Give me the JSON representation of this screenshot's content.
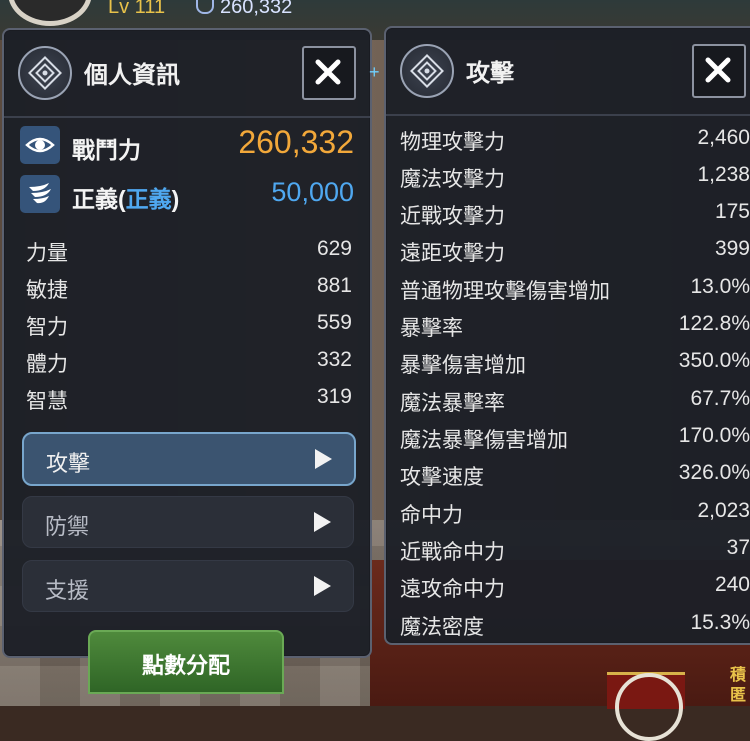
{
  "hud": {
    "level": "Lv 111",
    "combat_power": "260,332"
  },
  "left_panel": {
    "title": "個人資訊",
    "combat_power": {
      "label": "戰鬥力",
      "value": "260,332"
    },
    "justice": {
      "label_main": "正義(",
      "label_inner": "正義",
      "label_close": ")",
      "value": "50,000"
    },
    "stats": [
      {
        "label": "力量",
        "value": "629"
      },
      {
        "label": "敏捷",
        "value": "881"
      },
      {
        "label": "智力",
        "value": "559"
      },
      {
        "label": "體力",
        "value": "332"
      },
      {
        "label": "智慧",
        "value": "319"
      }
    ],
    "categories": [
      {
        "label": "攻擊",
        "active": true
      },
      {
        "label": "防禦",
        "active": false
      },
      {
        "label": "支援",
        "active": false
      }
    ],
    "distribute_button": "點數分配"
  },
  "right_panel": {
    "title": "攻擊",
    "rows": [
      {
        "label": "物理攻擊力",
        "value": "2,460"
      },
      {
        "label": "魔法攻擊力",
        "value": "1,238"
      },
      {
        "label": "近戰攻擊力",
        "value": "175"
      },
      {
        "label": "遠距攻擊力",
        "value": "399"
      },
      {
        "label": "普通物理攻擊傷害增加",
        "value": "13.0%"
      },
      {
        "label": "暴擊率",
        "value": "122.8%"
      },
      {
        "label": "暴擊傷害增加",
        "value": "350.0%"
      },
      {
        "label": "魔法暴擊率",
        "value": "67.7%"
      },
      {
        "label": "魔法暴擊傷害增加",
        "value": "170.0%"
      },
      {
        "label": "攻擊速度",
        "value": "326.0%"
      },
      {
        "label": "命中力",
        "value": "2,023"
      },
      {
        "label": "近戰命中力",
        "value": "37"
      },
      {
        "label": "遠攻命中力",
        "value": "240"
      },
      {
        "label": "魔法密度",
        "value": "15.3%"
      }
    ]
  },
  "badge_text": "積匿",
  "colors": {
    "power": "#f2a83a",
    "justice": "#4fa8f0",
    "panel_bg": "#1c1f26",
    "accent_green": "#4f8a3c"
  }
}
